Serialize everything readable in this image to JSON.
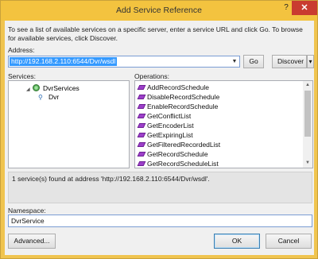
{
  "window": {
    "title": "Add Service Reference",
    "help_glyph": "?",
    "close_glyph": "✕"
  },
  "intro_text": "To see a list of available services on a specific server, enter a service URL and click Go. To browse for available services, click Discover.",
  "address": {
    "label": "Address:",
    "value": "http://192.168.2.110:6544/Dvr/wsdl",
    "dropdown_glyph": "▼"
  },
  "buttons": {
    "go": "Go",
    "discover": "Discover",
    "discover_arrow": "▾",
    "advanced": "Advanced...",
    "ok": "OK",
    "cancel": "Cancel"
  },
  "services": {
    "label": "Services:",
    "tree": [
      {
        "label": "DvrServices",
        "expand_glyph": "◢",
        "icon": "service-globe-icon"
      },
      {
        "label": "Dvr",
        "icon_glyph": "⚲",
        "icon": "interface-icon"
      }
    ]
  },
  "operations": {
    "label": "Operations:",
    "items": [
      "AddRecordSchedule",
      "DisableRecordSchedule",
      "EnableRecordSchedule",
      "GetConflictList",
      "GetEncoderList",
      "GetExpiringList",
      "GetFilteredRecordedList",
      "GetRecordSchedule",
      "GetRecordScheduleList"
    ],
    "scroll_up": "▲",
    "scroll_down": "▼"
  },
  "status_text": "1 service(s) found at address 'http://192.168.2.110:6544/Dvr/wsdl'.",
  "namespace": {
    "label": "Namespace:",
    "value": "DvrService"
  },
  "colors": {
    "titlebar": "#f3c33f",
    "close_button": "#c93c30",
    "selection": "#3399ff",
    "method_icon": "#9c3fc9"
  }
}
